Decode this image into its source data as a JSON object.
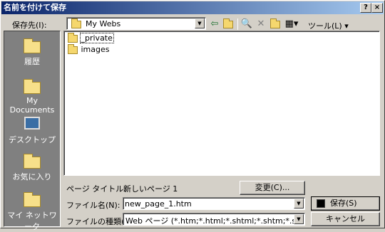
{
  "window": {
    "title": "名前を付けて保存",
    "help_label": "?",
    "close_label": "×"
  },
  "toolbar": {
    "save_in_label": "保存先(I):",
    "location": "My Webs",
    "tools_label": "ツール(L)"
  },
  "places": [
    {
      "label": "履歴",
      "icon": "history-icon"
    },
    {
      "label": "My Documents",
      "icon": "my-documents-icon"
    },
    {
      "label": "デスクトップ",
      "icon": "desktop-icon"
    },
    {
      "label": "お気に入り",
      "icon": "favorites-icon"
    },
    {
      "label": "マイ ネットワーク",
      "icon": "my-network-icon"
    }
  ],
  "files": [
    {
      "name": "_private",
      "icon": "folder-icon",
      "selected": true
    },
    {
      "name": "images",
      "icon": "folder-icon",
      "selected": false
    }
  ],
  "form": {
    "page_title_label": "ページ タイトル:",
    "page_title_value": "新しいページ 1",
    "change_button": "変更(C)...",
    "filename_label": "ファイル名(N):",
    "filename_value": "new_page_1.htm",
    "filetype_label": "ファイルの種類(T):",
    "filetype_value": "Web ページ (*.htm;*.html;*.shtml;*.shtm;*.stm;*.asp;*.",
    "save_button": "保存(S)",
    "cancel_button": "キャンセル"
  },
  "colors": {
    "title_start": "#0a246a",
    "title_end": "#a6caf0",
    "face": "#d4d0c8",
    "places_bg": "#808080",
    "folder": "#f5d76e"
  }
}
